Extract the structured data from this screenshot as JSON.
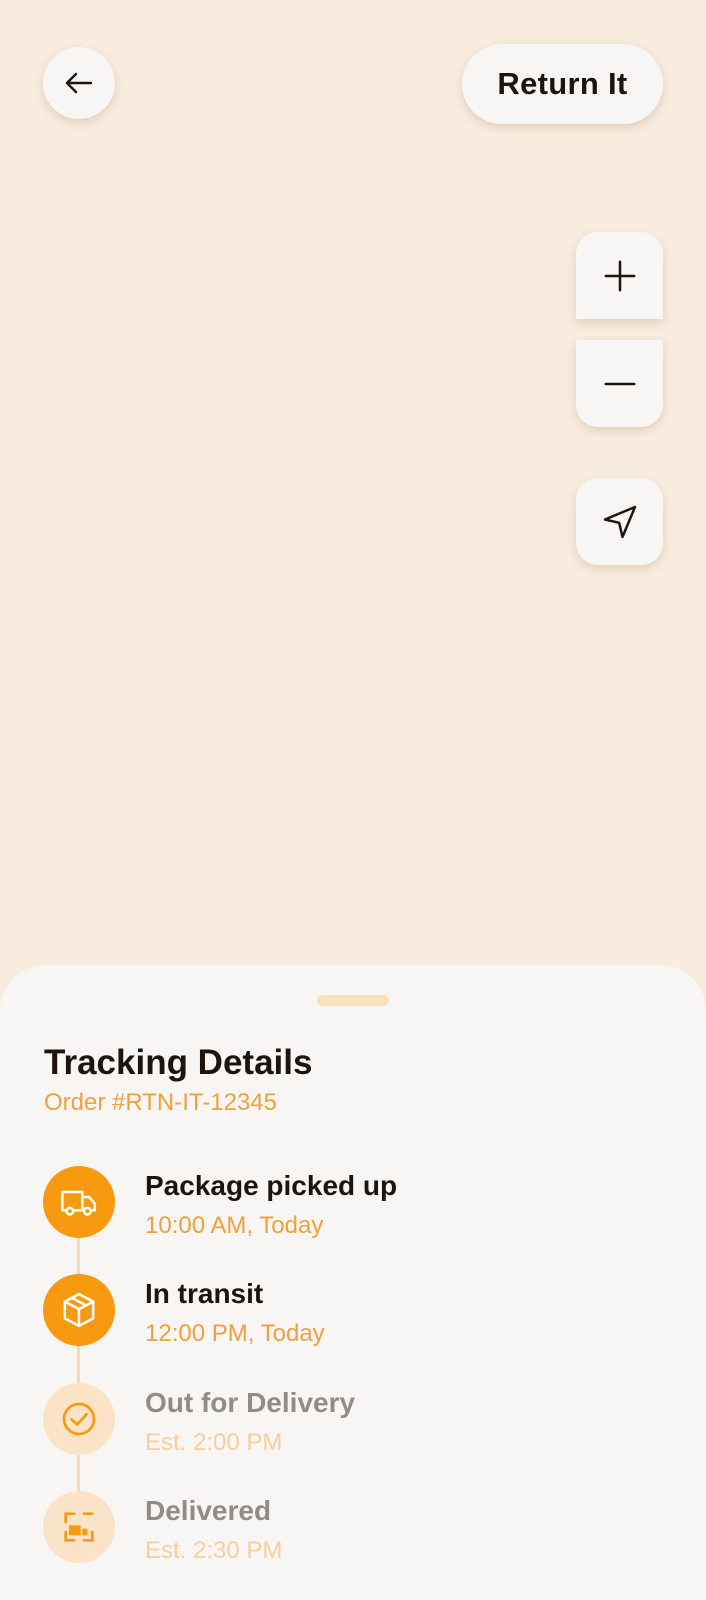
{
  "header": {
    "back_icon": "arrow-left-icon",
    "return_button_label": "Return It"
  },
  "map_controls": {
    "zoom_in_icon": "plus-icon",
    "zoom_out_icon": "minus-icon",
    "locate_icon": "navigation-arrow-icon"
  },
  "tracking": {
    "title": "Tracking Details",
    "order_number": "Order #RTN-IT-12345",
    "steps": [
      {
        "label": "Package picked up",
        "time": "10:00 AM, Today",
        "status": "done",
        "icon": "truck-icon"
      },
      {
        "label": "In transit",
        "time": "12:00 PM, Today",
        "status": "done",
        "icon": "package-box-icon"
      },
      {
        "label": "Out for Delivery",
        "time": "Est. 2:00 PM",
        "status": "pending",
        "icon": "check-circle-icon"
      },
      {
        "label": "Delivered",
        "time": "Est. 2:30 PM",
        "status": "pending",
        "icon": "delivered-package-icon"
      }
    ]
  },
  "colors": {
    "accent": "#F79A10",
    "accent_text": "#F0A03A",
    "pending_circle": "#FAE3C6",
    "map_background": "#F8ECDF",
    "sheet_background": "#F8F6F4"
  }
}
